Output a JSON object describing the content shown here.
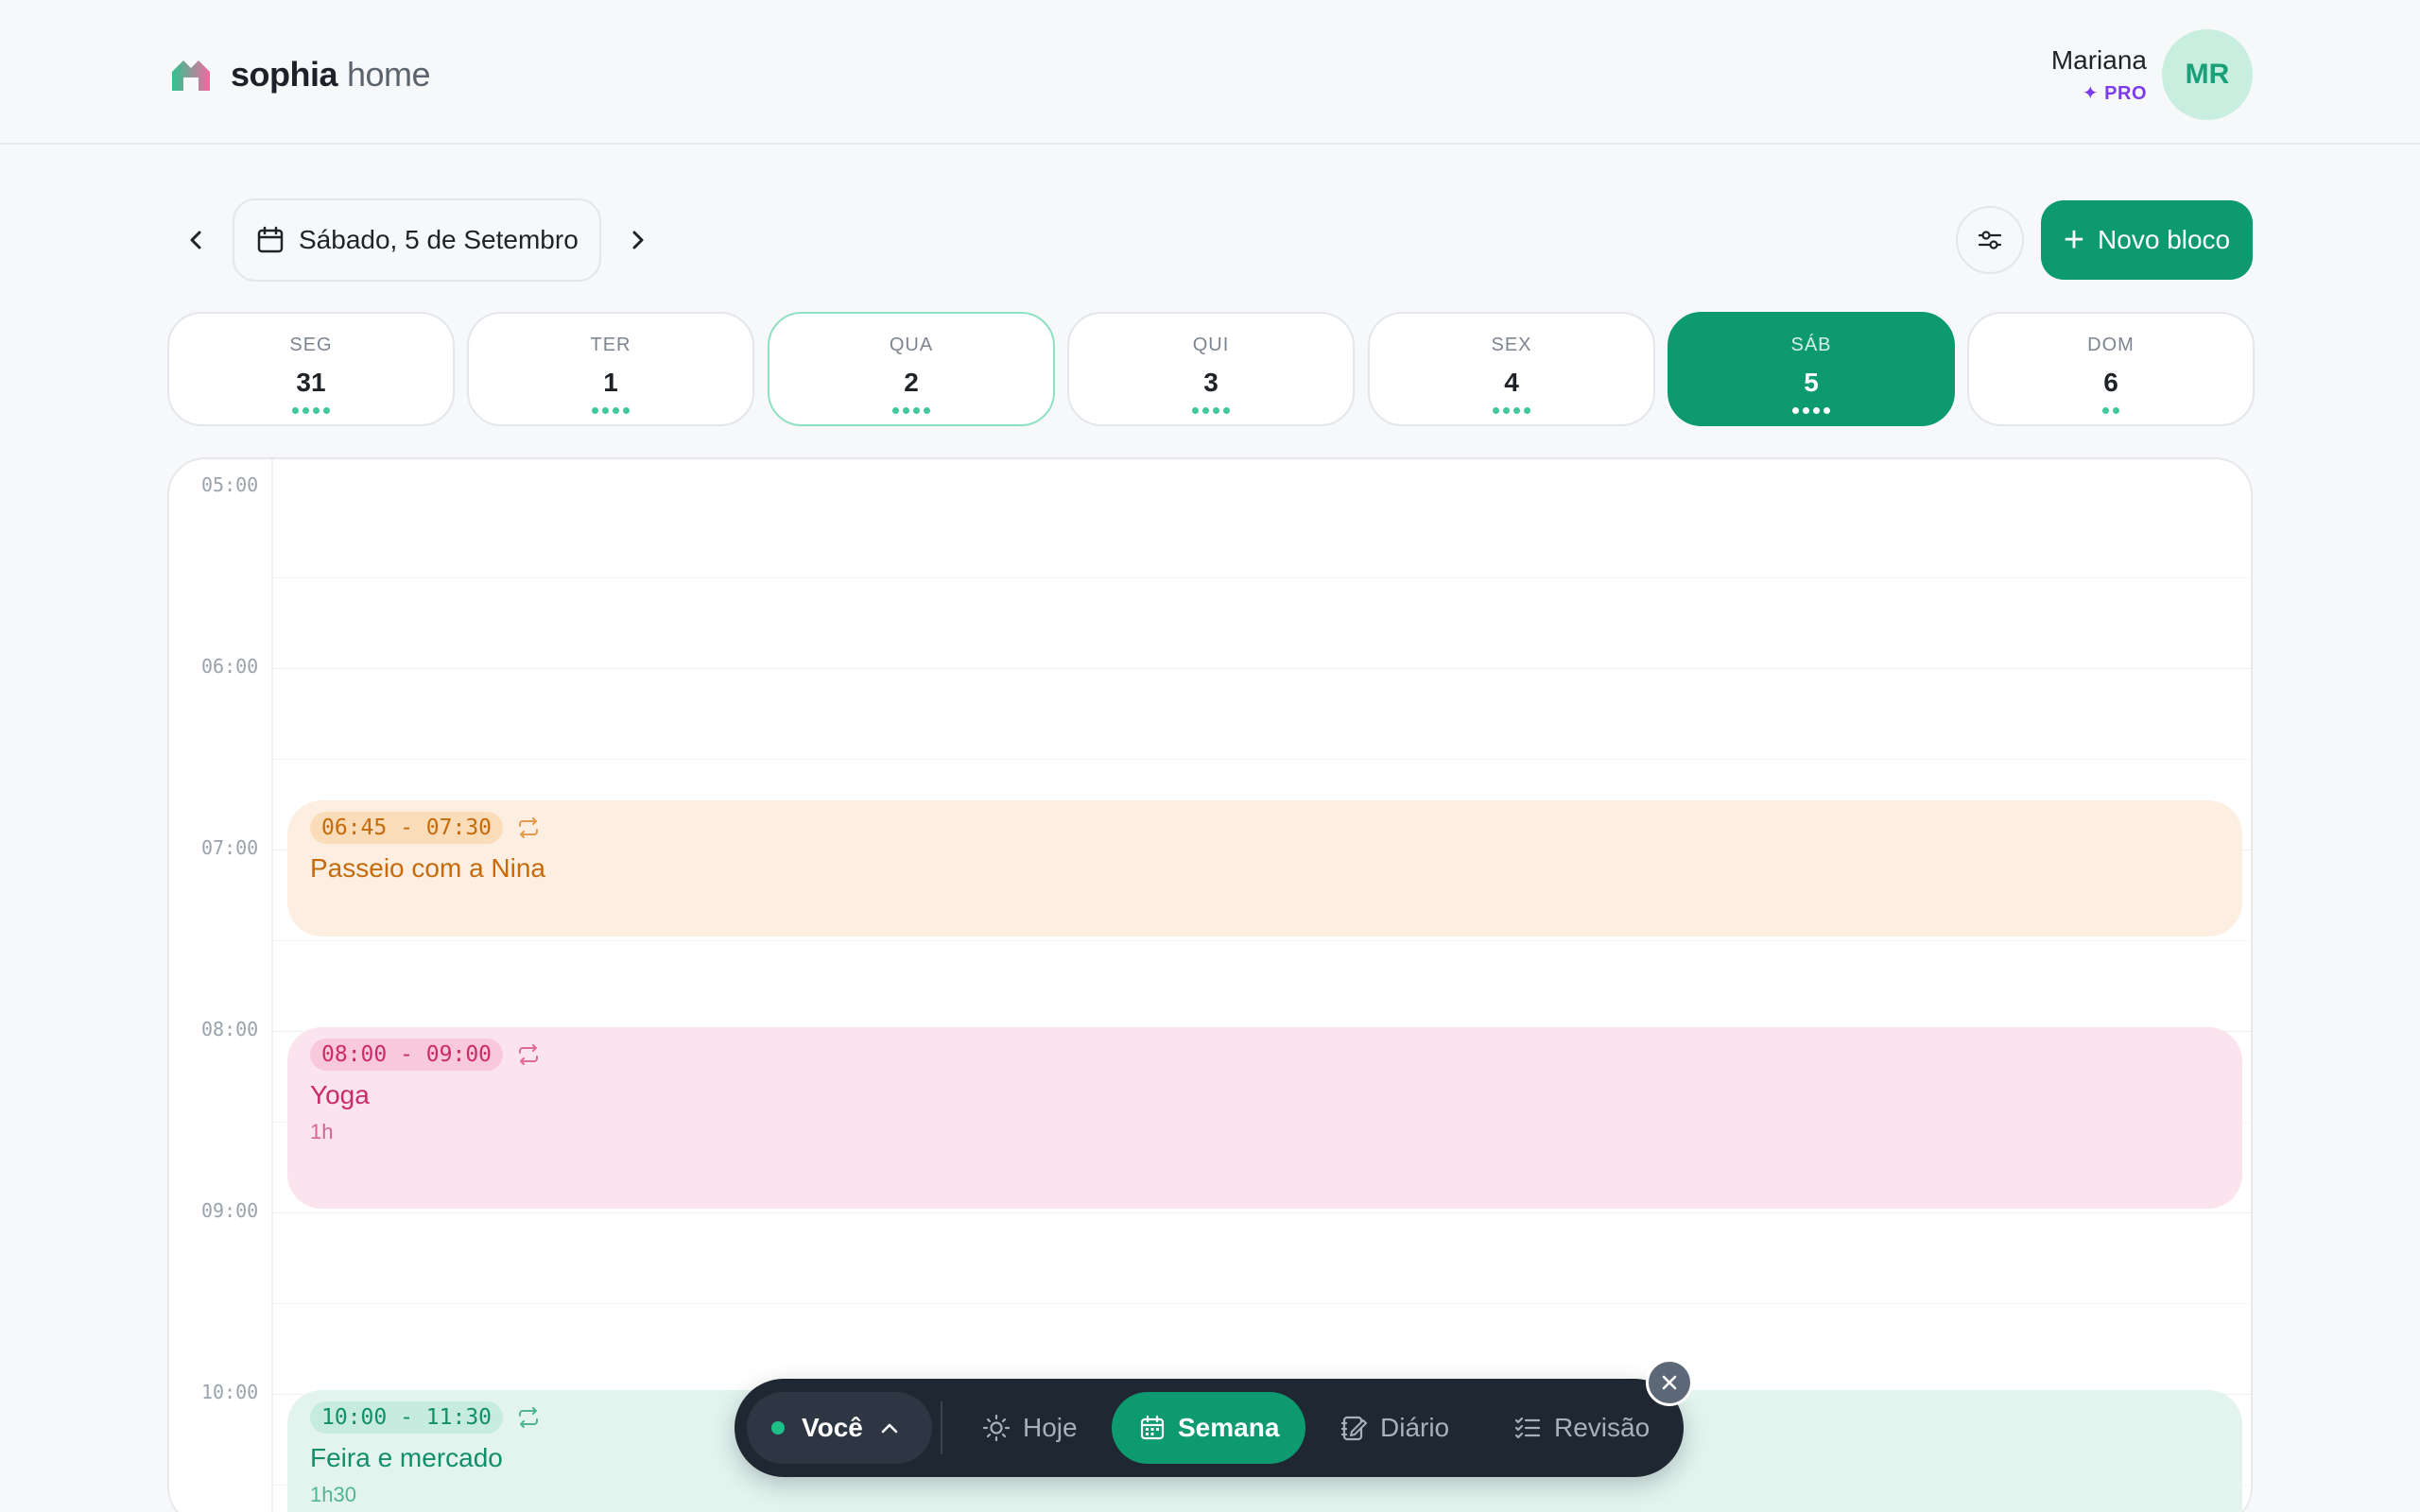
{
  "header": {
    "brand": "sophia",
    "brand_sub": "home",
    "user_name": "Mariana",
    "user_plan": "✦ PRO",
    "avatar_initials": "MR"
  },
  "toolbar": {
    "current_date": "Sábado, 5 de Setembro",
    "new_block_label": "Novo bloco",
    "prev_icon": "chevron-left-icon",
    "next_icon": "chevron-right-icon",
    "filter_icon": "sliders-icon"
  },
  "week": [
    {
      "name": "SEG",
      "num": "31",
      "dots": 4,
      "state": "normal"
    },
    {
      "name": "TER",
      "num": "1",
      "dots": 4,
      "state": "normal"
    },
    {
      "name": "QUA",
      "num": "2",
      "dots": 4,
      "state": "today"
    },
    {
      "name": "QUI",
      "num": "3",
      "dots": 4,
      "state": "normal"
    },
    {
      "name": "SEX",
      "num": "4",
      "dots": 4,
      "state": "normal"
    },
    {
      "name": "SÁB",
      "num": "5",
      "dots": 4,
      "state": "active"
    },
    {
      "name": "DOM",
      "num": "6",
      "dots": 2,
      "state": "normal"
    }
  ],
  "calendar": {
    "hours": [
      "05:00",
      "06:00",
      "07:00",
      "08:00",
      "09:00",
      "10:00"
    ],
    "events": [
      {
        "time": "06:45 - 07:30",
        "title": "Passeio com a Nina",
        "duration": "",
        "color": "#c66a0a",
        "recurring": true
      },
      {
        "time": "08:00 - 09:00",
        "title": "Yoga",
        "duration": "1h",
        "color": "#cc2a6a",
        "recurring": true
      },
      {
        "time": "10:00 - 11:30",
        "title": "Feira e mercado",
        "duration": "1h30",
        "color": "#128e69",
        "recurring": true
      }
    ]
  },
  "dock": {
    "user_label": "Você",
    "items": [
      {
        "label": "Hoje",
        "icon": "sun-icon",
        "active": false
      },
      {
        "label": "Semana",
        "icon": "calendar-icon",
        "active": true
      },
      {
        "label": "Diário",
        "icon": "journal-icon",
        "active": false
      },
      {
        "label": "Revisão",
        "icon": "checklist-icon",
        "active": false
      }
    ]
  },
  "colors": {
    "accent": "#0c9a6e",
    "pro": "#7c3aed"
  }
}
